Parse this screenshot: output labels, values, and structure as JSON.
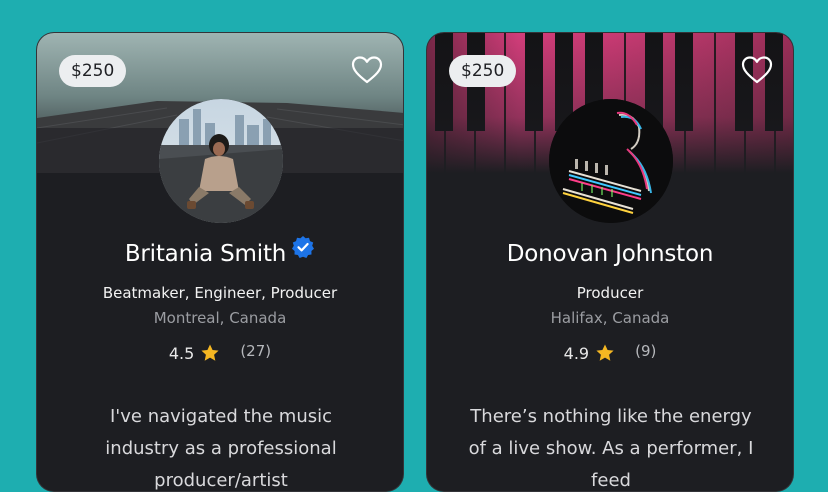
{
  "cards": [
    {
      "price": "$250",
      "name": "Britania Smith",
      "verified": true,
      "roles": "Beatmaker, Engineer, Producer",
      "location": "Montreal, Canada",
      "rating": "4.5",
      "review_count": "(27)",
      "bio": "I've navigated the music industry as a professional producer/artist"
    },
    {
      "price": "$250",
      "name": "Donovan Johnston",
      "verified": false,
      "roles": "Producer",
      "location": "Halifax, Canada",
      "rating": "4.9",
      "review_count": "(9)",
      "bio": "There’s nothing like the energy of a live show. As a performer, I feed"
    }
  ],
  "colors": {
    "background": "#1eaeb0",
    "card": "#1d1e22",
    "star": "#f5b722",
    "verified": "#1d74e8"
  },
  "icons": {
    "favorite": "heart-outline-icon",
    "verified": "verified-badge-icon",
    "rating": "star-icon"
  }
}
